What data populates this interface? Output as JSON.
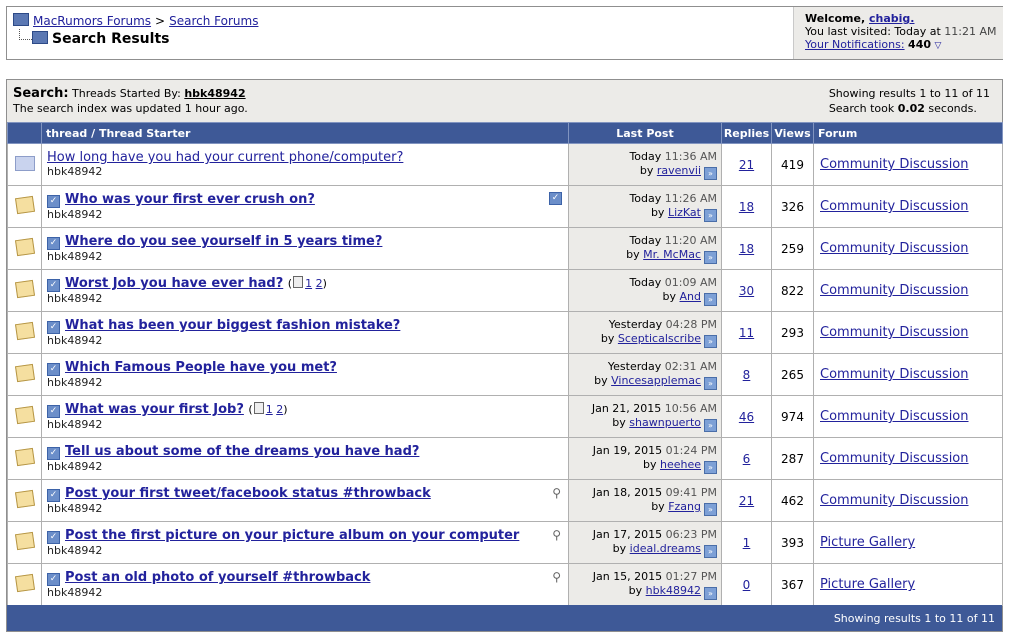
{
  "nav": {
    "crumb_home": "MacRumors Forums",
    "crumb_sep": ">",
    "crumb_search": "Search Forums",
    "page_title": "Search Results",
    "welcome_label": "Welcome,",
    "username": "chabig.",
    "last_visited_label": "You last visited:",
    "last_visited_value": "Today at",
    "last_visited_time": "11:21 AM",
    "notifications_label": "Your Notifications:",
    "notifications_count": "440"
  },
  "search": {
    "label": "Search:",
    "query_text": "Threads Started By:",
    "query_user": "hbk48942",
    "index_note": "The search index was updated 1 hour ago.",
    "showing": "Showing results 1 to 11 of 11",
    "took_label": "Search took",
    "took_value": "0.02",
    "took_unit": "seconds."
  },
  "columns": {
    "thread": "thread / Thread Starter",
    "last_post": "Last Post",
    "replies": "Replies",
    "views": "Views",
    "forum": "Forum"
  },
  "threads": [
    {
      "title": "How long have you had your current phone/computer?",
      "starter": "hbk48942",
      "date": "Today",
      "time": "11:36 AM",
      "by": "ravenvii",
      "replies": "21",
      "views": "419",
      "forum": "Community Discussion"
    },
    {
      "title": "Who was your first ever crush on?",
      "starter": "hbk48942",
      "date": "Today",
      "time": "11:26 AM",
      "by": "LizKat",
      "replies": "18",
      "views": "326",
      "forum": "Community Discussion"
    },
    {
      "title": "Where do you see yourself in 5 years time?",
      "starter": "hbk48942",
      "date": "Today",
      "time": "11:20 AM",
      "by": "Mr. McMac",
      "replies": "18",
      "views": "259",
      "forum": "Community Discussion"
    },
    {
      "title": "Worst Job you have ever had?",
      "starter": "hbk48942",
      "page1": "1",
      "page2": "2",
      "date": "Today",
      "time": "01:09 AM",
      "by": "And",
      "replies": "30",
      "views": "822",
      "forum": "Community Discussion"
    },
    {
      "title": "What has been your biggest fashion mistake?",
      "starter": "hbk48942",
      "date": "Yesterday",
      "time": "04:28 PM",
      "by": "Scepticalscribe",
      "replies": "11",
      "views": "293",
      "forum": "Community Discussion"
    },
    {
      "title": "Which Famous People have you met?",
      "starter": "hbk48942",
      "date": "Yesterday",
      "time": "02:31 AM",
      "by": "Vincesapplemac",
      "replies": "8",
      "views": "265",
      "forum": "Community Discussion"
    },
    {
      "title": "What was your first Job?",
      "starter": "hbk48942",
      "page1": "1",
      "page2": "2",
      "date": "Jan 21, 2015",
      "time": "10:56 AM",
      "by": "shawnpuerto",
      "replies": "46",
      "views": "974",
      "forum": "Community Discussion"
    },
    {
      "title": "Tell us about some of the dreams you have had?",
      "starter": "hbk48942",
      "date": "Jan 19, 2015",
      "time": "01:24 PM",
      "by": "heehee",
      "replies": "6",
      "views": "287",
      "forum": "Community Discussion"
    },
    {
      "title": "Post your first tweet/facebook status #throwback",
      "starter": "hbk48942",
      "date": "Jan 18, 2015",
      "time": "09:41 PM",
      "by": "Fzang",
      "replies": "21",
      "views": "462",
      "forum": "Community Discussion"
    },
    {
      "title": "Post the first picture on your picture album on your computer",
      "starter": "hbk48942",
      "date": "Jan 17, 2015",
      "time": "06:23 PM",
      "by": "ideal.dreams",
      "replies": "1",
      "views": "393",
      "forum": "Picture Gallery"
    },
    {
      "title": "Post an old photo of yourself #throwback",
      "starter": "hbk48942",
      "date": "Jan 15, 2015",
      "time": "01:27 PM",
      "by": "hbk48942",
      "replies": "0",
      "views": "367",
      "forum": "Picture Gallery"
    }
  ],
  "by_label": "by",
  "footer_showing": "Showing results 1 to 11 of 11",
  "colors": {
    "header_bg": "#3e5997",
    "link": "#22229c",
    "panel_bg": "#ecebe8"
  }
}
